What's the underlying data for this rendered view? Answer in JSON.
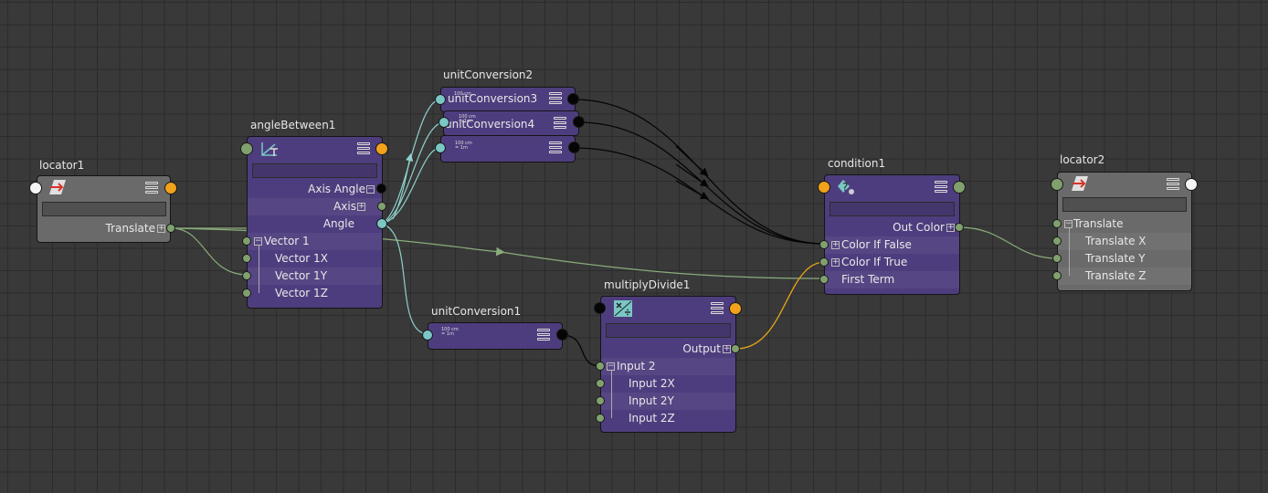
{
  "colors": {
    "background": "#393939",
    "node_purple": "#4e3d7e",
    "node_gray": "#6a6a6a",
    "port_green": "#80a06e",
    "port_cyan": "#7ac7c6",
    "port_orange": "#f2a11a",
    "wire_green": "#8aac7a",
    "wire_cyan": "#8fd1cc",
    "wire_black": "#050505",
    "wire_orange": "#e8a516"
  },
  "locator1": {
    "title": "locator1",
    "translate": "Translate",
    "icon": "locator-icon"
  },
  "angleBetween1": {
    "title": "angleBetween1",
    "icon": "angle-between-icon",
    "axis_angle": "Axis Angle",
    "axis": "Axis",
    "angle": "Angle",
    "vector1": "Vector 1",
    "vector1x": "Vector 1X",
    "vector1y": "Vector 1Y",
    "vector1z": "Vector 1Z"
  },
  "unitConversion2": {
    "title": "unitConversion2",
    "mini1": "100 cm",
    "mini2": "= 1m"
  },
  "unitConversion3": {
    "title": "unitConversion3",
    "mini1": "100 cm",
    "mini2": "= 1m"
  },
  "unitConversion4": {
    "title": "unitConversion4",
    "mini1": "100 cm",
    "mini2": "= 1m"
  },
  "unitConversion1": {
    "title": "unitConversion1",
    "mini1": "100 cm",
    "mini2": "= 1m"
  },
  "multiplyDivide1": {
    "title": "multiplyDivide1",
    "icon": "multiply-divide-icon",
    "output": "Output",
    "input2": "Input 2",
    "input2x": "Input 2X",
    "input2y": "Input 2Y",
    "input2z": "Input 2Z"
  },
  "condition1": {
    "title": "condition1",
    "icon": "condition-icon",
    "out_color": "Out Color",
    "color_if_false": "Color If False",
    "color_if_true": "Color If True",
    "first_term": "First Term"
  },
  "locator2": {
    "title": "locator2",
    "icon": "locator-icon",
    "translate": "Translate",
    "translate_x": "Translate X",
    "translate_y": "Translate Y",
    "translate_z": "Translate Z"
  }
}
